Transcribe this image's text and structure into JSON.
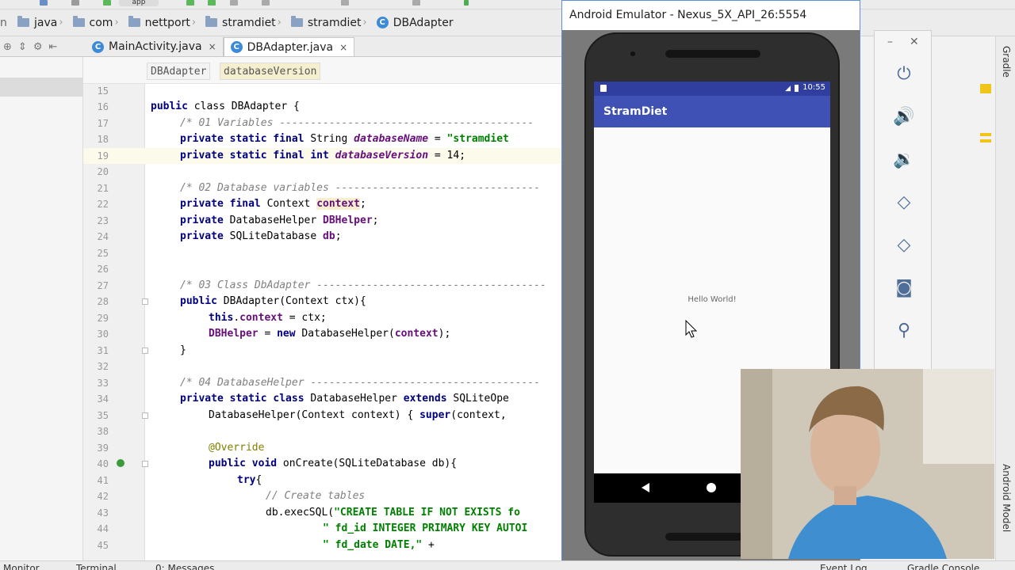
{
  "toolbar": {
    "app_label": "app"
  },
  "breadcrumb": [
    {
      "label": "java",
      "icon": "folder-icon"
    },
    {
      "label": "com",
      "icon": "folder-icon"
    },
    {
      "label": "nettport",
      "icon": "folder-icon"
    },
    {
      "label": "stramdiet",
      "icon": "folder-icon"
    },
    {
      "label": "stramdiet",
      "icon": "folder-icon"
    },
    {
      "label": "DBAdapter",
      "icon": "class-icon"
    }
  ],
  "tabs": [
    {
      "label": "MainActivity.java",
      "close": "×",
      "active": false
    },
    {
      "label": "DBAdapter.java",
      "close": "×",
      "active": true
    }
  ],
  "editor": {
    "path_pills": [
      "DBAdapter",
      "databaseVersion"
    ],
    "lines": [
      {
        "n": "15"
      },
      {
        "n": "16"
      },
      {
        "n": "17"
      },
      {
        "n": "18"
      },
      {
        "n": "19"
      },
      {
        "n": "20"
      },
      {
        "n": "21"
      },
      {
        "n": "22"
      },
      {
        "n": "23"
      },
      {
        "n": "24"
      },
      {
        "n": "25"
      },
      {
        "n": "26"
      },
      {
        "n": "27"
      },
      {
        "n": "28"
      },
      {
        "n": "29"
      },
      {
        "n": "30"
      },
      {
        "n": "31"
      },
      {
        "n": "32"
      },
      {
        "n": "33"
      },
      {
        "n": "34"
      },
      {
        "n": "35"
      },
      {
        "n": "38"
      },
      {
        "n": "39"
      },
      {
        "n": "40"
      },
      {
        "n": "41"
      },
      {
        "n": "42"
      },
      {
        "n": "43"
      },
      {
        "n": "44"
      },
      {
        "n": "45"
      }
    ],
    "code": {
      "l16a": "public",
      "l16b": " class DBAdapter {",
      "l17": "/* 01 Variables -----------------------------------------",
      "l18a": "private static final",
      "l18b": " String ",
      "l18c": "databaseName",
      "l18d": " = ",
      "l18e": "\"stramdiet",
      "l19a": "private static final int",
      "l19b": " ",
      "l19c": "databaseVersion",
      "l19d": " = 14;",
      "l21": "/* 02 Database variables ---------------------------------",
      "l22a": "private final",
      "l22b": " Context ",
      "l22c": "context",
      "l22d": ";",
      "l23a": "private",
      "l23b": " DatabaseHelper ",
      "l23c": "DBHelper",
      "l23d": ";",
      "l24a": "private",
      "l24b": " SQLiteDatabase ",
      "l24c": "db",
      "l24d": ";",
      "l27": "/* 03 Class DbAdapter -------------------------------------",
      "l28a": "public",
      "l28b": " DBAdapter(Context ctx){",
      "l29a": "this",
      "l29b": ".",
      "l29c": "context",
      "l29d": " = ctx;",
      "l30a": "DBHelper",
      "l30b": " = ",
      "l30c": "new",
      "l30d": " DatabaseHelper(",
      "l30e": "context",
      "l30f": ");",
      "l31": "}",
      "l33": "/* 04 DatabaseHelper -------------------------------------",
      "l34a": "private static class",
      "l34b": " DatabaseHelper ",
      "l34c": "extends",
      "l34d": " SQLiteOpe",
      "l35a": "DatabaseHelper(Context context) { ",
      "l35b": "super",
      "l35c": "(context,",
      "l38": "@Override",
      "l39a": "public void",
      "l39b": " onCreate(SQLiteDatabase db){",
      "l40a": "try",
      "l40b": "{",
      "l41": "// Create tables",
      "l42a": "db.execSQL(",
      "l42b": "\"CREATE TABLE IF NOT EXISTS fo",
      "l43": "\" fd_id INTEGER PRIMARY KEY AUTOI",
      "l44a": "\" fd_date DATE,\"",
      "l44b": " +"
    }
  },
  "emulator": {
    "title": "Android Emulator - Nexus_5X_API_26:5554",
    "time": "10:55",
    "app_title": "StramDiet",
    "hello": "Hello World!",
    "controls": [
      "power-icon",
      "volume-up-icon",
      "volume-down-icon",
      "rotate-left-icon",
      "rotate-right-icon",
      "camera-icon",
      "zoom-icon"
    ]
  },
  "side_labels": {
    "gradle": "Gradle",
    "android_model": "Android Model"
  },
  "bottom_bar": {
    "monitor": "Monitor",
    "terminal": "Terminal",
    "messages": "0: Messages",
    "event_log": "Event Log",
    "gradle_console": "Gradle Console"
  }
}
